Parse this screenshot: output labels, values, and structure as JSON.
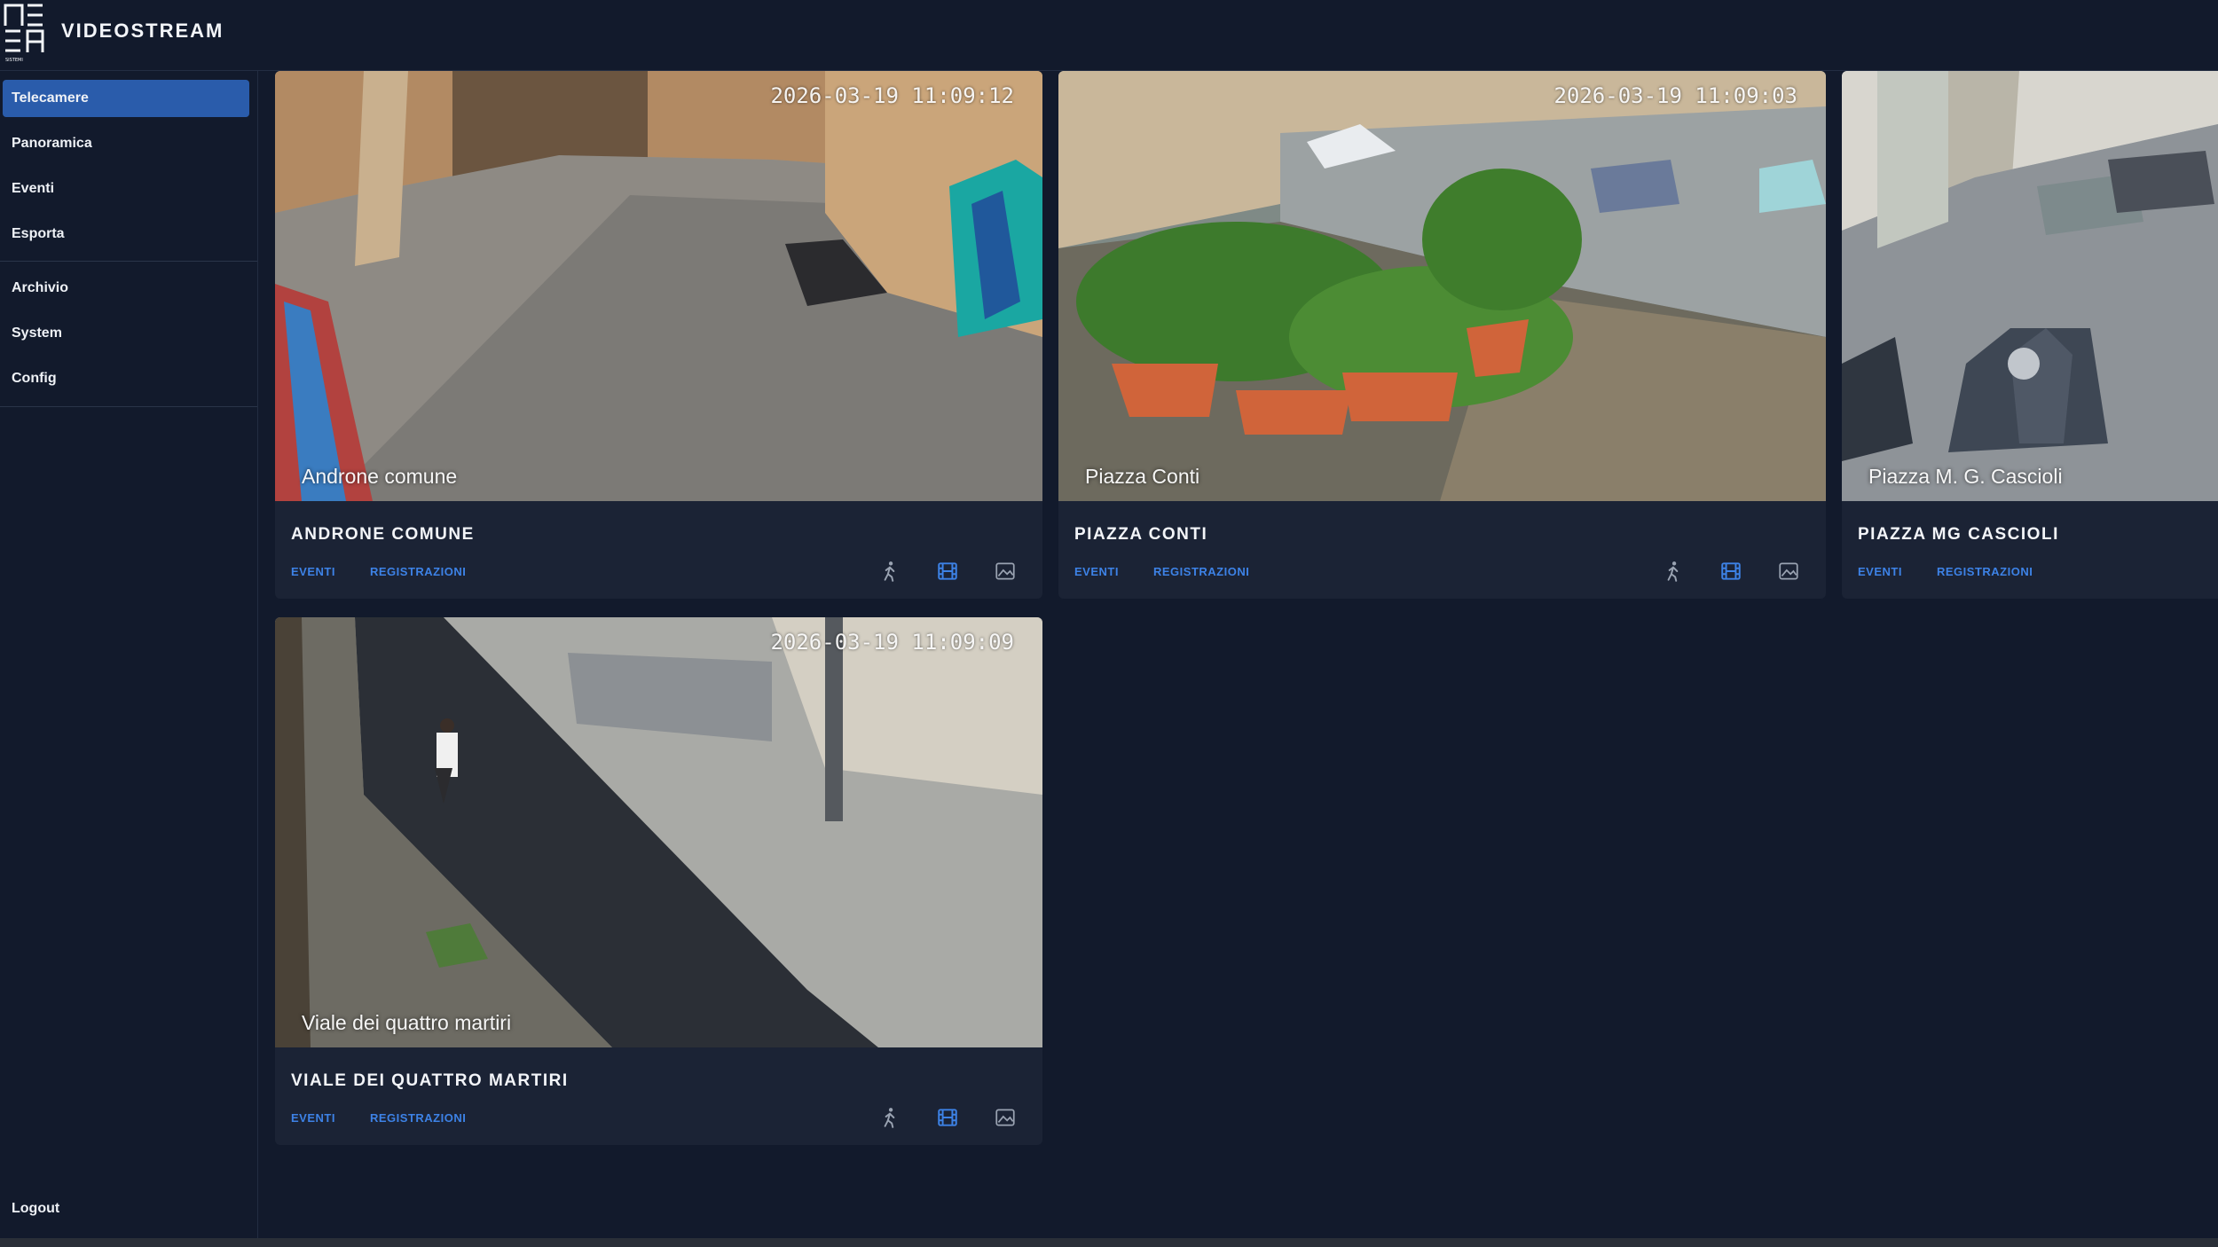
{
  "app": {
    "title": "VIDEOSTREAM"
  },
  "sidebar": {
    "items": [
      {
        "label": "Telecamere",
        "active": true
      },
      {
        "label": "Panoramica"
      },
      {
        "label": "Eventi"
      },
      {
        "label": "Esporta"
      },
      {
        "label": "Archivio"
      },
      {
        "label": "System"
      },
      {
        "label": "Config"
      }
    ],
    "logout": "Logout"
  },
  "cameras": [
    {
      "title": "ANDRONE COMUNE",
      "overlay": "Androne comune",
      "timestamp": "2026-03-19 11:09:12",
      "links": {
        "events": "EVENTI",
        "recordings": "REGISTRAZIONI"
      }
    },
    {
      "title": "PIAZZA CONTI",
      "overlay": "Piazza Conti",
      "timestamp": "2026-03-19 11:09:03",
      "links": {
        "events": "EVENTI",
        "recordings": "REGISTRAZIONI"
      }
    },
    {
      "title": "PIAZZA MG CASCIOLI",
      "overlay": "Piazza M. G. Cascioli",
      "timestamp": "",
      "links": {
        "events": "EVENTI",
        "recordings": "REGISTRAZIONI"
      }
    },
    {
      "title": "VIALE DEI QUATTRO MARTIRI",
      "overlay": "Viale dei quattro martiri",
      "timestamp": "2026-03-19 11:09:09",
      "links": {
        "events": "EVENTI",
        "recordings": "REGISTRAZIONI"
      }
    }
  ],
  "icons": {
    "motion": "person-walking-icon",
    "recordings": "film-icon",
    "snapshot": "image-icon"
  },
  "colors": {
    "accent": "#2a5cab",
    "link": "#3d82e6",
    "background": "#121a2c",
    "card": "#1b2335"
  }
}
